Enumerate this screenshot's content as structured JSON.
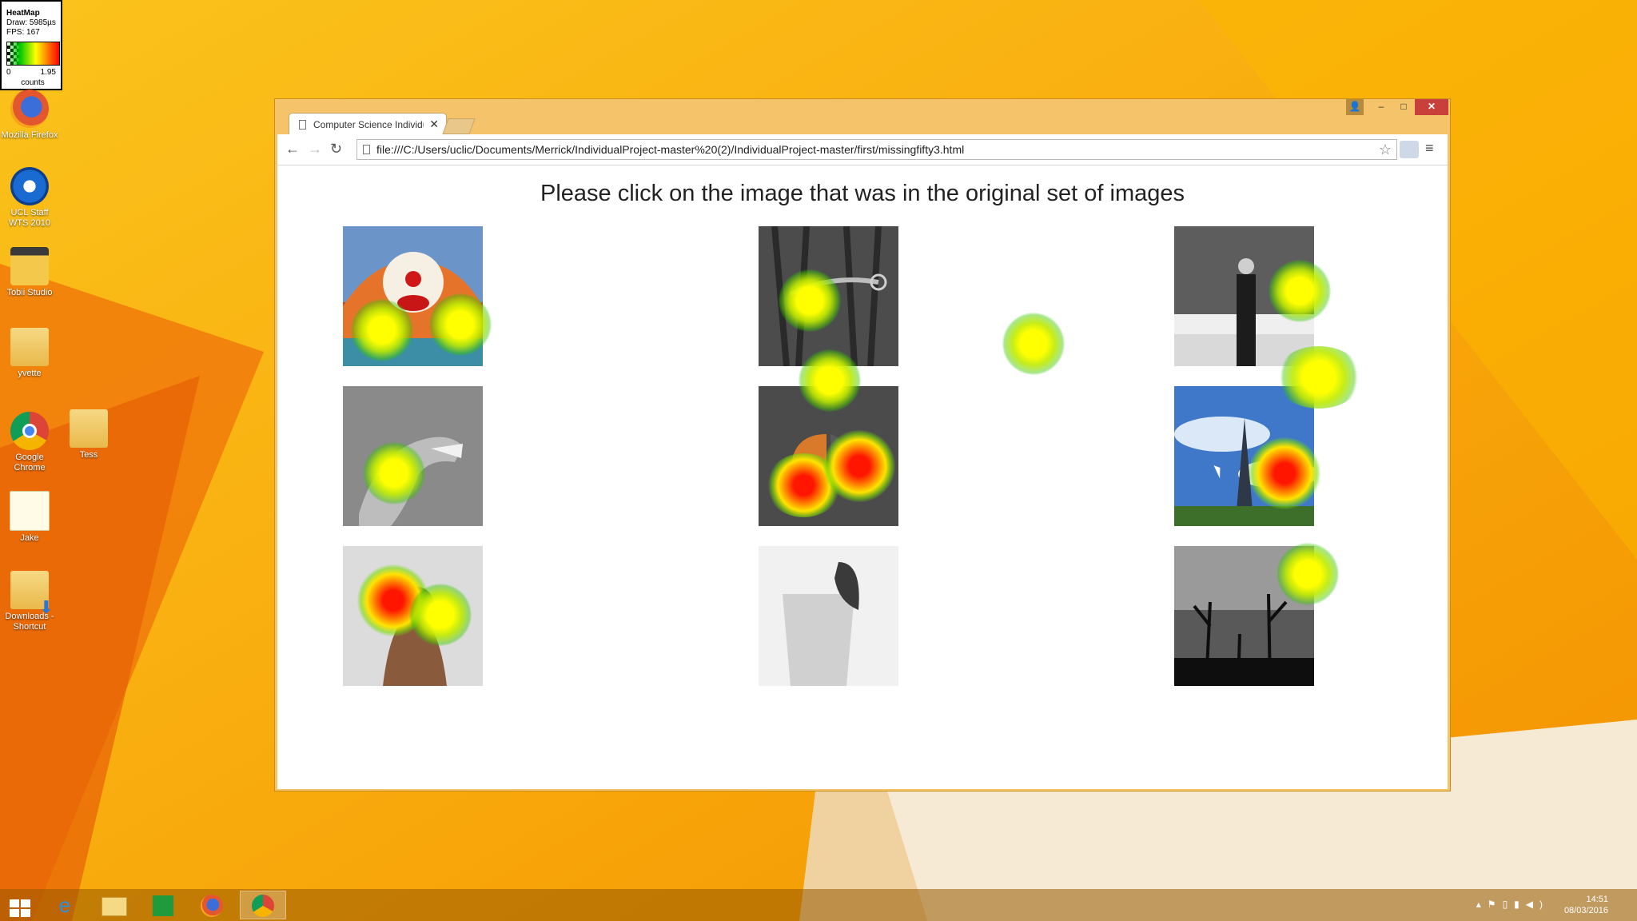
{
  "heatmap_legend": {
    "title": "HeatMap",
    "draw": "Draw: 5985µs",
    "fps": "FPS: 167",
    "min": "0",
    "max": "1.95",
    "unit": "counts"
  },
  "desktop_icons": [
    {
      "label": "Mozilla Firefox",
      "icon": "firefox-icon"
    },
    {
      "label": "UCL Staff WTS 2010",
      "icon": "remote-desktop-icon"
    },
    {
      "label": "Tobii Studio",
      "icon": "tobii-studio-icon"
    },
    {
      "label": "yvette",
      "icon": "folder-icon"
    },
    {
      "label": "Google Chrome",
      "icon": "chrome-icon"
    },
    {
      "label": "Tess",
      "icon": "folder-icon"
    },
    {
      "label": "Jake",
      "icon": "file-icon"
    },
    {
      "label": "Downloads - Shortcut",
      "icon": "downloads-folder-icon"
    }
  ],
  "browser": {
    "tab_title": "Computer Science Individual",
    "url": "file:///C:/Users/uclic/Documents/Merrick/IndividualProject-master%20(2)/IndividualProject-master/first/missingfifty3.html",
    "window_controls": [
      "–",
      "□",
      "✕"
    ]
  },
  "page": {
    "heading": "Please click on the image that was in the original set of images",
    "images": [
      {
        "subject": "clown"
      },
      {
        "subject": "tree bark"
      },
      {
        "subject": "person standing"
      },
      {
        "subject": "dinosaur"
      },
      {
        "subject": "butterfly"
      },
      {
        "subject": "eiffel tower"
      },
      {
        "subject": "hat"
      },
      {
        "subject": "strawberry drink"
      },
      {
        "subject": "dead trees"
      }
    ]
  },
  "taskbar": {
    "time": "14:51",
    "date": "08/03/2016",
    "apps": [
      "start",
      "internet-explorer",
      "file-explorer",
      "store",
      "firefox",
      "chrome"
    ]
  }
}
